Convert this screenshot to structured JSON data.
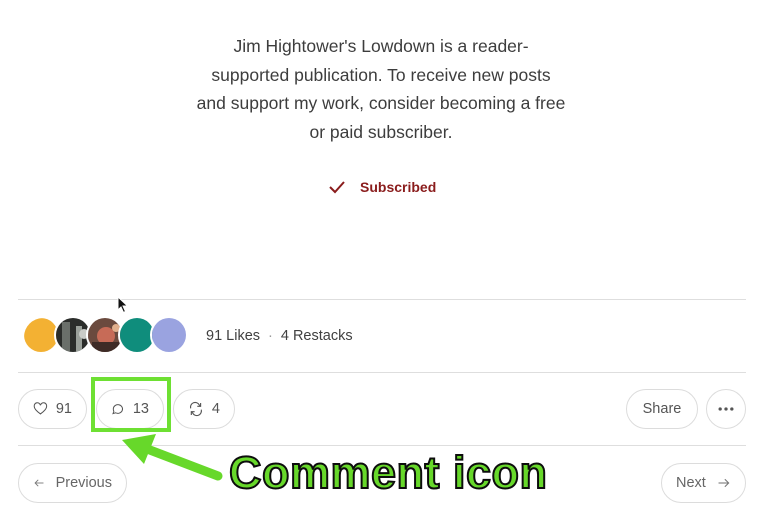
{
  "promo": {
    "line1": "Jim Hightower's Lowdown is a reader-",
    "line2": "supported publication. To receive new posts",
    "line3": "and support my work, consider becoming a free",
    "line4": "or paid subscriber."
  },
  "subscribe": {
    "label": "Subscribed",
    "color": "#8a1c1c"
  },
  "engagement": {
    "likes": "91 Likes",
    "separator": "·",
    "restacks": "4 Restacks"
  },
  "actions": {
    "like_count": "91",
    "comment_count": "13",
    "restack_count": "4",
    "share_label": "Share"
  },
  "navigation": {
    "previous": "Previous",
    "next": "Next"
  },
  "annotation": {
    "label": "Comment icon",
    "color": "#6ee033"
  },
  "icons": [
    "check-icon",
    "heart-icon",
    "comment-icon",
    "restack-icon",
    "more-icon",
    "arrow-left-icon",
    "arrow-right-icon"
  ]
}
